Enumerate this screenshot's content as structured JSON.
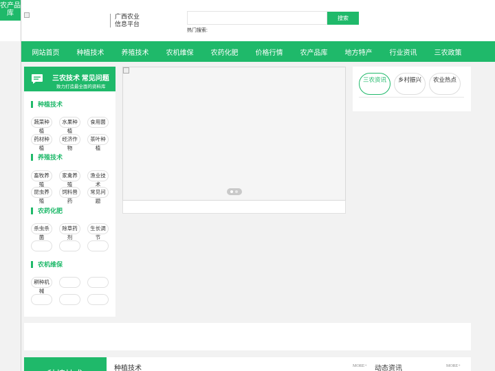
{
  "side_tab": "农产品库",
  "brand": {
    "name": "广西农业信息平台"
  },
  "search": {
    "placeholder": "",
    "button": "搜索",
    "hot_label": "热门搜索:"
  },
  "nav": [
    "网站首页",
    "种植技术",
    "养殖技术",
    "农机维保",
    "农药化肥",
    "价格行情",
    "农产品库",
    "地方特产",
    "行业资讯",
    "三农政策"
  ],
  "faq": {
    "title": "三农技术 常见问题",
    "subtitle": "致力打造最全面的资料库"
  },
  "categories": [
    {
      "name": "种植技术",
      "tags": [
        "蔬菜种植",
        "水果种植",
        "食用菌",
        "药材种植",
        "经济作物",
        "茶叶种植"
      ]
    },
    {
      "name": "养殖技术",
      "tags": [
        "畜牧养殖",
        "家禽养殖",
        "渔业技术",
        "昆虫养殖",
        "饲料兽药",
        "常见问题"
      ]
    },
    {
      "name": "农药化肥",
      "tags": [
        "杀虫杀菌",
        "除草药剂",
        "生长调节",
        "",
        "",
        ""
      ]
    },
    {
      "name": "农机维保",
      "tags": [
        "耕种机械",
        "",
        "",
        "",
        "",
        ""
      ]
    }
  ],
  "right_tabs": [
    "三农资讯",
    "乡村振兴",
    "农业热点"
  ],
  "bottom": {
    "green_label": "种植技术",
    "section1": "种植技术",
    "section2": "动态资讯",
    "more": "MORE+"
  },
  "colors": {
    "brand_green": "#1fb96a"
  }
}
